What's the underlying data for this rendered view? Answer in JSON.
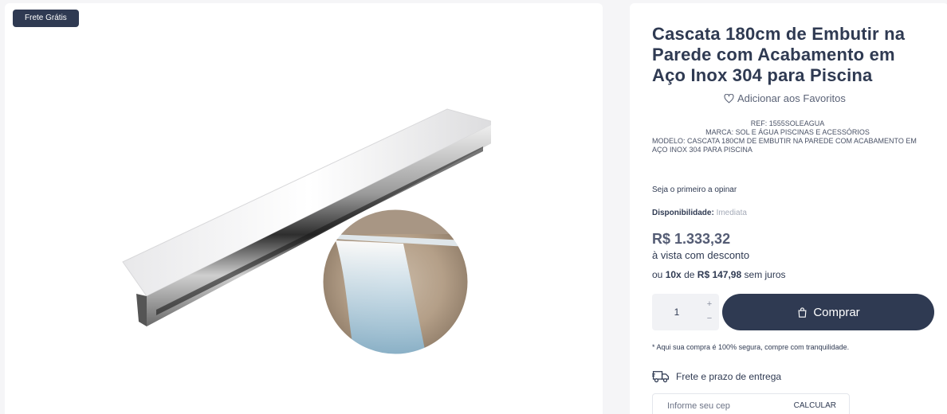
{
  "badge": {
    "label": "Frete Grátis"
  },
  "product": {
    "title": "Cascata 180cm de Embutir na Parede com Acabamento em Aço Inox 304 para Piscina",
    "favorite_label": "Adicionar aos Favoritos",
    "ref": "REF:  1555SOLEAGUA",
    "brand": "MARCA: SOL E ÁGUA PISCINAS E ACESSÓRIOS",
    "model": "MODELO: CASCATA 180CM DE EMBUTIR NA PAREDE COM ACABAMENTO EM AÇO INOX 304 PARA PISCINA",
    "opinion": "Seja o primeiro a opinar",
    "availability_label": "Disponibilidade:",
    "availability_value": "Imediata",
    "price": "R$ 1.333,32",
    "cash_note": "à vista com desconto",
    "installment_prefix": "ou",
    "installment_count": "10x",
    "installment_mid": "de",
    "installment_value": "R$ 147,98",
    "installment_suffix": "sem juros"
  },
  "purchase": {
    "quantity": "1",
    "plus": "+",
    "minus": "−",
    "buy_label": "Comprar",
    "secure_note": "* Aqui sua compra é 100% segura, compre com tranquilidade."
  },
  "shipping": {
    "label": "Frete e prazo de entrega",
    "cep_placeholder": "Informe seu cep",
    "calc_label": "CALCULAR"
  },
  "icons": [
    "heart-icon",
    "shopping-bag-icon",
    "delivery-truck-icon"
  ],
  "colors": {
    "primary": "#2f3a52",
    "background": "#f5f5f7",
    "muted": "#a5abb8"
  }
}
